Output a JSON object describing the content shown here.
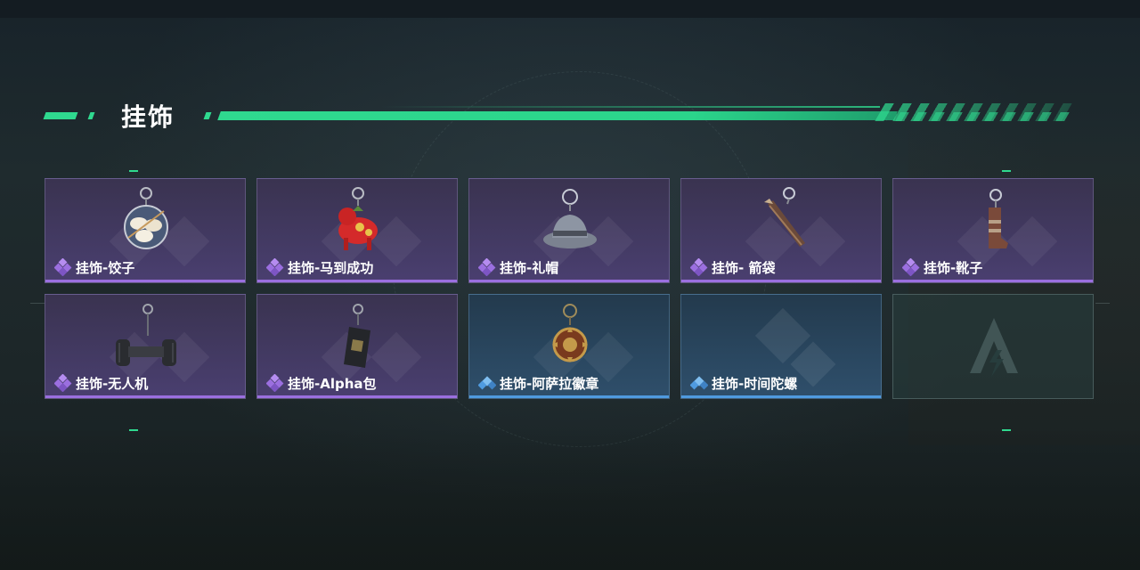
{
  "section": {
    "title": "挂饰"
  },
  "colors": {
    "accent_green": "#2fd98f",
    "rarity_purple": "#9b6fe0",
    "rarity_blue": "#4f9be0",
    "card_purple_bg": "#433a63",
    "card_blue_bg": "#2a4760",
    "card_empty_bg": "#283e3e"
  },
  "items": [
    {
      "label": "挂饰-饺子",
      "rarity": "purple",
      "icon": "dumplings-charm-icon"
    },
    {
      "label": "挂饰-马到成功",
      "rarity": "purple",
      "icon": "red-horse-charm-icon"
    },
    {
      "label": "挂饰-礼帽",
      "rarity": "purple",
      "icon": "fedora-hat-charm-icon"
    },
    {
      "label": "挂饰- 箭袋",
      "rarity": "purple",
      "icon": "quiver-charm-icon"
    },
    {
      "label": "挂饰-靴子",
      "rarity": "purple",
      "icon": "boot-charm-icon"
    },
    {
      "label": "挂饰-无人机",
      "rarity": "purple",
      "icon": "drone-charm-icon"
    },
    {
      "label": "挂饰-Alpha包",
      "rarity": "purple",
      "icon": "alpha-pouch-charm-icon"
    },
    {
      "label": "挂饰-阿萨拉徽章",
      "rarity": "blue",
      "icon": "asala-badge-charm-icon"
    },
    {
      "label": "挂饰-时间陀螺",
      "rarity": "blue",
      "icon": "time-gyro-charm-icon"
    },
    {
      "label": "",
      "rarity": "empty",
      "icon": "empty-slot-logo-icon"
    }
  ]
}
